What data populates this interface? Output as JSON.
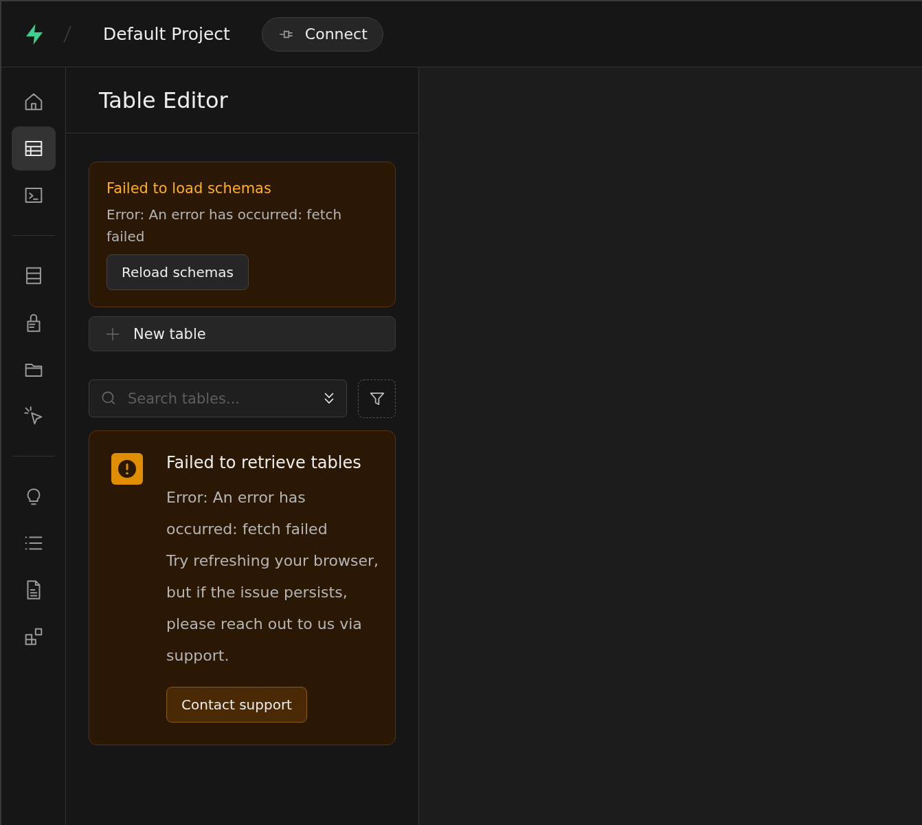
{
  "header": {
    "project": "Default Project",
    "connect_button": "Connect"
  },
  "nav": [
    [
      {
        "selected": false
      },
      {
        "selected": true
      },
      {
        "selected": false
      }
    ],
    [
      {
        "selected": false
      },
      {
        "selected": false
      },
      {
        "selected": false
      },
      {
        "selected": false
      }
    ],
    [
      {
        "selected": false
      },
      {
        "selected": false
      },
      {
        "selected": false
      },
      {
        "selected": false
      }
    ]
  ],
  "panel": {
    "title": "Table Editor",
    "schema_alert": {
      "title": "Failed to load schemas",
      "message": "Error: An error has occurred: fetch failed",
      "button": "Reload schemas"
    },
    "new_table_button": "New table",
    "search": {
      "placeholder": "Search tables..."
    },
    "tables_alert": {
      "title": "Failed to retrieve tables",
      "messages": [
        "Error: An error has occurred: fetch failed",
        "Try refreshing your browser, but if the issue persists, please reach out to us via support."
      ],
      "button": "Contact support"
    }
  }
}
